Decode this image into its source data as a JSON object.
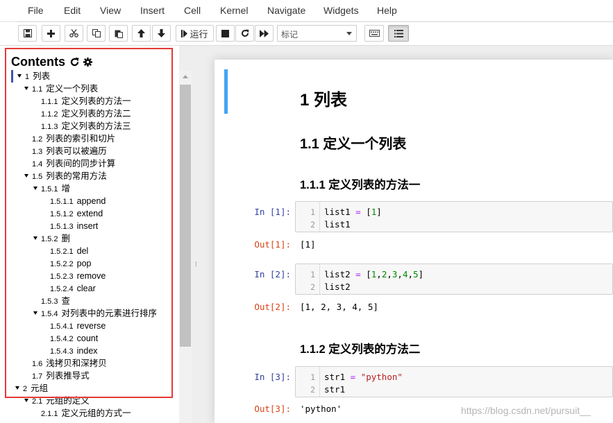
{
  "menu": {
    "items": [
      "File",
      "Edit",
      "View",
      "Insert",
      "Cell",
      "Kernel",
      "Navigate",
      "Widgets",
      "Help"
    ]
  },
  "toolbar": {
    "run_label": "运行",
    "cell_type": "标记"
  },
  "toc": {
    "title": "Contents",
    "items": [
      {
        "num": "1",
        "text": "列表"
      },
      {
        "num": "1.1",
        "text": "定义一个列表"
      },
      {
        "num": "1.1.1",
        "text": "定义列表的方法一"
      },
      {
        "num": "1.1.2",
        "text": "定义列表的方法二"
      },
      {
        "num": "1.1.3",
        "text": "定义列表的方法三"
      },
      {
        "num": "1.2",
        "text": "列表的索引和切片"
      },
      {
        "num": "1.3",
        "text": "列表可以被遍历"
      },
      {
        "num": "1.4",
        "text": "列表间的同步计算"
      },
      {
        "num": "1.5",
        "text": "列表的常用方法"
      },
      {
        "num": "1.5.1",
        "text": "增"
      },
      {
        "num": "1.5.1.1",
        "text": "append"
      },
      {
        "num": "1.5.1.2",
        "text": "extend"
      },
      {
        "num": "1.5.1.3",
        "text": "insert"
      },
      {
        "num": "1.5.2",
        "text": "删"
      },
      {
        "num": "1.5.2.1",
        "text": "del"
      },
      {
        "num": "1.5.2.2",
        "text": "pop"
      },
      {
        "num": "1.5.2.3",
        "text": "remove"
      },
      {
        "num": "1.5.2.4",
        "text": "clear"
      },
      {
        "num": "1.5.3",
        "text": "查"
      },
      {
        "num": "1.5.4",
        "text": "对列表中的元素进行排序"
      },
      {
        "num": "1.5.4.1",
        "text": "reverse"
      },
      {
        "num": "1.5.4.2",
        "text": "count"
      },
      {
        "num": "1.5.4.3",
        "text": "index"
      },
      {
        "num": "1.6",
        "text": "浅拷贝和深拷贝"
      },
      {
        "num": "1.7",
        "text": "列表推导式"
      },
      {
        "num": "2",
        "text": "元组"
      },
      {
        "num": "2.1",
        "text": "元组的定义"
      },
      {
        "num": "2.1.1",
        "text": "定义元组的方式一"
      }
    ]
  },
  "notebook": {
    "h1": "1  列表",
    "h2": "1.1  定义一个列表",
    "h3a": "1.1.1  定义列表的方法一",
    "h3b": "1.1.2  定义列表的方法二",
    "cells": [
      {
        "in": "In  [1]:",
        "out": "Out[1]:",
        "line2": "list1",
        "output": "[1]"
      },
      {
        "in": "In  [2]:",
        "out": "Out[2]:",
        "line2": "list2",
        "output": "[1, 2, 3, 4, 5]"
      },
      {
        "in": "In  [3]:",
        "out": "Out[3]:",
        "line2": "str1",
        "output": "'python'"
      }
    ],
    "code": {
      "c1_var": "list1",
      "c1_eq": "=",
      "c1_open": "[",
      "c1_n": "1",
      "c1_close": "]",
      "c2_var": "list2",
      "c2_eq": "=",
      "c2_open": "[",
      "c2_nums": [
        "1",
        "2",
        "3",
        "4",
        "5"
      ],
      "c2_close": "]",
      "c3_var": "str1",
      "c3_eq": "=",
      "c3_str": "\"python\""
    },
    "line_numbers": [
      "1",
      "2"
    ]
  },
  "watermark": "https://blog.csdn.net/pursuit__"
}
